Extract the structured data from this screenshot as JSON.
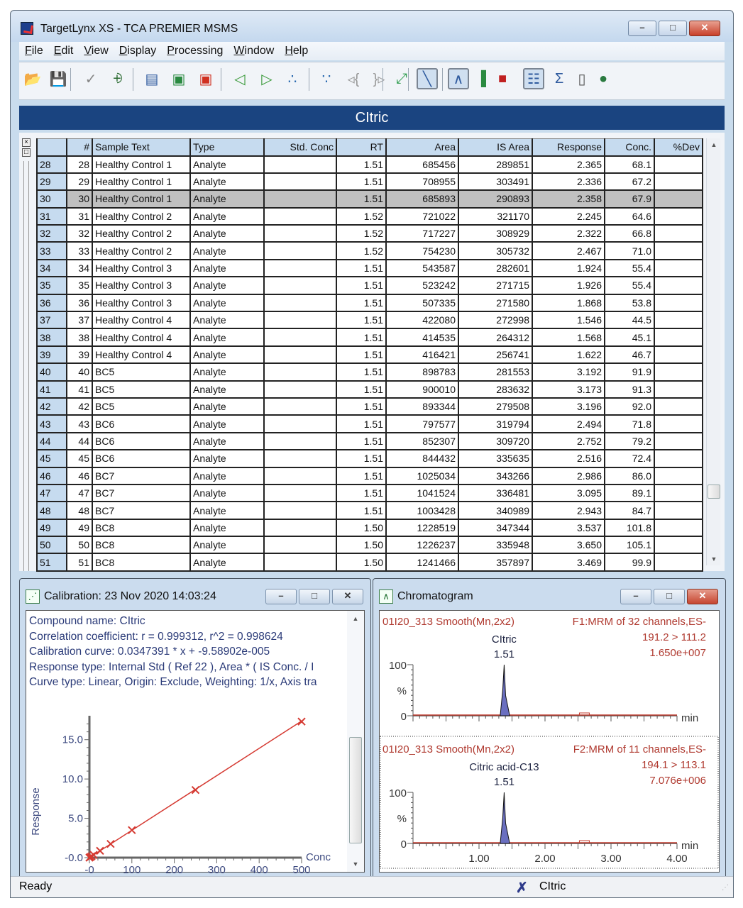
{
  "window": {
    "title": "TargetLynx XS - TCA PREMIER MSMS",
    "controls": {
      "minimize": "–",
      "maximize": "□",
      "close": "✕"
    }
  },
  "menu": [
    {
      "label": "File",
      "accel": "F",
      "rest": "ile"
    },
    {
      "label": "Edit",
      "accel": "E",
      "rest": "dit"
    },
    {
      "label": "View",
      "accel": "V",
      "rest": "iew"
    },
    {
      "label": "Display",
      "accel": "D",
      "rest": "isplay"
    },
    {
      "label": "Processing",
      "accel": "P",
      "rest": "rocessing"
    },
    {
      "label": "Window",
      "accel": "W",
      "rest": "indow"
    },
    {
      "label": "Help",
      "accel": "H",
      "rest": "elp"
    }
  ],
  "toolbar": [
    {
      "name": "open-icon",
      "glyph": "📂"
    },
    {
      "name": "save-icon",
      "glyph": "💾"
    },
    {
      "name": "manual-integrate-icon",
      "glyph": "✓"
    },
    {
      "name": "peak-split-icon",
      "glyph": "⨮"
    },
    {
      "name": "chromatogram-window-icon",
      "glyph": "▤"
    },
    {
      "name": "peak-display-icon",
      "glyph": "▣"
    },
    {
      "name": "peak-alert-icon",
      "glyph": "▣"
    },
    {
      "name": "previous-sample-icon",
      "glyph": "◁"
    },
    {
      "name": "next-sample-icon",
      "glyph": "▷"
    },
    {
      "name": "previous-compound-icon",
      "glyph": "∴"
    },
    {
      "name": "next-compound-icon",
      "glyph": "∵"
    },
    {
      "name": "previous-group-icon",
      "glyph": "◃{"
    },
    {
      "name": "next-group-icon",
      "glyph": "}▹"
    },
    {
      "name": "fit-window-icon",
      "glyph": "⤢"
    },
    {
      "name": "calibration-view-icon",
      "glyph": "╲"
    },
    {
      "name": "chromatogram-view-icon",
      "glyph": "∧"
    },
    {
      "name": "spectrum-view-icon",
      "glyph": "▐"
    },
    {
      "name": "summary-chart-icon",
      "glyph": "■"
    },
    {
      "name": "table-view-icon",
      "glyph": "☷"
    },
    {
      "name": "sum-icon",
      "glyph": "Σ"
    },
    {
      "name": "book-icon",
      "glyph": "▯"
    },
    {
      "name": "globe-icon",
      "glyph": "●"
    }
  ],
  "compound_banner": "CItric",
  "table": {
    "columns": [
      "",
      "#",
      "Sample Text",
      "Type",
      "Std. Conc",
      "RT",
      "Area",
      "IS Area",
      "Response",
      "Conc.",
      "%Dev"
    ],
    "selected_row": 30,
    "rows": [
      [
        "28",
        "28",
        "Healthy Control 1",
        "Analyte",
        "",
        "1.51",
        "685456",
        "289851",
        "2.365",
        "68.1",
        ""
      ],
      [
        "29",
        "29",
        "Healthy Control 1",
        "Analyte",
        "",
        "1.51",
        "708955",
        "303491",
        "2.336",
        "67.2",
        ""
      ],
      [
        "30",
        "30",
        "Healthy Control 1",
        "Analyte",
        "",
        "1.51",
        "685893",
        "290893",
        "2.358",
        "67.9",
        ""
      ],
      [
        "31",
        "31",
        "Healthy Control 2",
        "Analyte",
        "",
        "1.52",
        "721022",
        "321170",
        "2.245",
        "64.6",
        ""
      ],
      [
        "32",
        "32",
        "Healthy Control 2",
        "Analyte",
        "",
        "1.52",
        "717227",
        "308929",
        "2.322",
        "66.8",
        ""
      ],
      [
        "33",
        "33",
        "Healthy Control 2",
        "Analyte",
        "",
        "1.52",
        "754230",
        "305732",
        "2.467",
        "71.0",
        ""
      ],
      [
        "34",
        "34",
        "Healthy Control 3",
        "Analyte",
        "",
        "1.51",
        "543587",
        "282601",
        "1.924",
        "55.4",
        ""
      ],
      [
        "35",
        "35",
        "Healthy Control 3",
        "Analyte",
        "",
        "1.51",
        "523242",
        "271715",
        "1.926",
        "55.4",
        ""
      ],
      [
        "36",
        "36",
        "Healthy Control 3",
        "Analyte",
        "",
        "1.51",
        "507335",
        "271580",
        "1.868",
        "53.8",
        ""
      ],
      [
        "37",
        "37",
        "Healthy Control 4",
        "Analyte",
        "",
        "1.51",
        "422080",
        "272998",
        "1.546",
        "44.5",
        ""
      ],
      [
        "38",
        "38",
        "Healthy Control 4",
        "Analyte",
        "",
        "1.51",
        "414535",
        "264312",
        "1.568",
        "45.1",
        ""
      ],
      [
        "39",
        "39",
        "Healthy Control 4",
        "Analyte",
        "",
        "1.51",
        "416421",
        "256741",
        "1.622",
        "46.7",
        ""
      ],
      [
        "40",
        "40",
        "BC5",
        "Analyte",
        "",
        "1.51",
        "898783",
        "281553",
        "3.192",
        "91.9",
        ""
      ],
      [
        "41",
        "41",
        "BC5",
        "Analyte",
        "",
        "1.51",
        "900010",
        "283632",
        "3.173",
        "91.3",
        ""
      ],
      [
        "42",
        "42",
        "BC5",
        "Analyte",
        "",
        "1.51",
        "893344",
        "279508",
        "3.196",
        "92.0",
        ""
      ],
      [
        "43",
        "43",
        "BC6",
        "Analyte",
        "",
        "1.51",
        "797577",
        "319794",
        "2.494",
        "71.8",
        ""
      ],
      [
        "44",
        "44",
        "BC6",
        "Analyte",
        "",
        "1.51",
        "852307",
        "309720",
        "2.752",
        "79.2",
        ""
      ],
      [
        "45",
        "45",
        "BC6",
        "Analyte",
        "",
        "1.51",
        "844432",
        "335635",
        "2.516",
        "72.4",
        ""
      ],
      [
        "46",
        "46",
        "BC7",
        "Analyte",
        "",
        "1.51",
        "1025034",
        "343266",
        "2.986",
        "86.0",
        ""
      ],
      [
        "47",
        "47",
        "BC7",
        "Analyte",
        "",
        "1.51",
        "1041524",
        "336481",
        "3.095",
        "89.1",
        ""
      ],
      [
        "48",
        "48",
        "BC7",
        "Analyte",
        "",
        "1.51",
        "1003428",
        "340989",
        "2.943",
        "84.7",
        ""
      ],
      [
        "49",
        "49",
        "BC8",
        "Analyte",
        "",
        "1.50",
        "1228519",
        "347344",
        "3.537",
        "101.8",
        ""
      ],
      [
        "50",
        "50",
        "BC8",
        "Analyte",
        "",
        "1.50",
        "1226237",
        "335948",
        "3.650",
        "105.1",
        ""
      ],
      [
        "51",
        "51",
        "BC8",
        "Analyte",
        "",
        "1.50",
        "1241466",
        "357897",
        "3.469",
        "99.9",
        ""
      ]
    ]
  },
  "calibration": {
    "title": "Calibration: 23 Nov 2020 14:03:24",
    "lines": [
      "Compound name: CItric",
      "Correlation coefficient: r = 0.999312, r^2 = 0.998624",
      "Calibration curve: 0.0347391 * x + -9.58902e-005",
      "Response type: Internal Std ( Ref 22 ), Area * ( IS Conc. / I",
      "Curve type: Linear, Origin: Exclude, Weighting: 1/x, Axis tra"
    ]
  },
  "chromatogram": {
    "title": "Chromatogram",
    "traces": [
      {
        "sample": "01I20_313 Smooth(Mn,2x2)",
        "function": "F1:MRM of 32 channels,ES-",
        "transition": "191.2 > 111.2",
        "intensity": "1.650e+007",
        "peak_name": "CItric",
        "peak_rt": "1.51",
        "y_label": "%",
        "y_top": "100",
        "y_zero": "0",
        "x_unit": "min"
      },
      {
        "sample": "01I20_313 Smooth(Mn,2x2)",
        "function": "F2:MRM of 11 channels,ES-",
        "transition": "194.1 > 113.1",
        "intensity": "7.076e+006",
        "peak_name": "Citric acid-C13",
        "peak_rt": "1.51",
        "y_label": "%",
        "y_top": "100",
        "y_zero": "0",
        "x_unit": "min"
      }
    ],
    "x_ticks": [
      "1.00",
      "2.00",
      "3.00",
      "4.00"
    ]
  },
  "chart_data": [
    {
      "type": "scatter",
      "title": "Calibration",
      "xlabel": "Conc",
      "ylabel": "Response",
      "xlim": [
        0,
        500
      ],
      "ylim": [
        0,
        17.5
      ],
      "x_ticks": [
        "-0",
        "100",
        "200",
        "300",
        "400",
        "500"
      ],
      "y_ticks": [
        "-0.0",
        "5.0",
        "10.0",
        "15.0"
      ],
      "points": [
        [
          0,
          0
        ],
        [
          2,
          0.07
        ],
        [
          5,
          0.17
        ],
        [
          10,
          0.35
        ],
        [
          25,
          0.87
        ],
        [
          50,
          1.74
        ],
        [
          100,
          3.5
        ],
        [
          250,
          8.6
        ],
        [
          500,
          17.3
        ]
      ],
      "fit": {
        "slope": 0.0347391,
        "intercept": -9.58902e-05
      },
      "series_color": "#d53a32"
    },
    {
      "type": "line",
      "title": "CItric 191.2 > 111.2",
      "xlabel": "min",
      "ylabel": "%",
      "xlim": [
        0,
        4.2
      ],
      "ylim": [
        0,
        100
      ],
      "peak": {
        "rt": 1.51,
        "height": 100,
        "width": 0.06
      }
    },
    {
      "type": "line",
      "title": "Citric acid-C13 194.1 > 113.1",
      "xlabel": "min",
      "ylabel": "%",
      "xlim": [
        0,
        4.2
      ],
      "ylim": [
        0,
        100
      ],
      "peak": {
        "rt": 1.51,
        "height": 100,
        "width": 0.06
      }
    }
  ],
  "status": {
    "left": "Ready",
    "compound": "CItric"
  }
}
